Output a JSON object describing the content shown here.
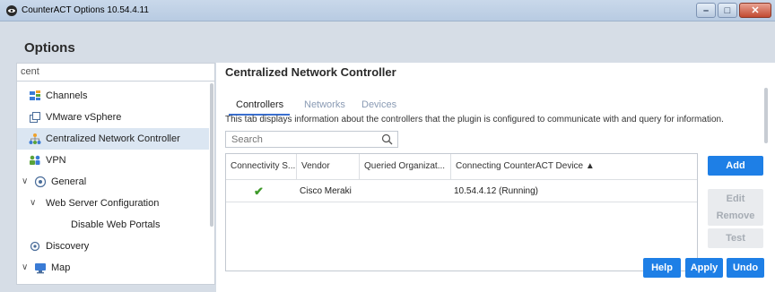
{
  "window": {
    "title": "CounterACT Options 10.54.4.11",
    "controls": {
      "minimize": "–",
      "maximize": "□",
      "close": "✕"
    }
  },
  "header": {
    "heading": "Options"
  },
  "sidebar": {
    "search_value": "cent",
    "items": [
      {
        "label": "Channels",
        "icon": "channels-icon"
      },
      {
        "label": "VMware vSphere",
        "icon": "vsphere-icon"
      },
      {
        "label": "Centralized Network Controller",
        "icon": "network-controller-icon",
        "selected": true
      },
      {
        "label": "VPN",
        "icon": "vpn-icon"
      },
      {
        "label": "General",
        "icon": "general-gear-icon",
        "expandable": true
      },
      {
        "label": "Web Server Configuration",
        "expandable": true
      },
      {
        "label": "Disable Web Portals"
      },
      {
        "label": "Discovery",
        "icon": "discovery-icon"
      },
      {
        "label": "Map",
        "icon": "map-icon",
        "expandable": true
      }
    ]
  },
  "main": {
    "title": "Centralized Network Controller",
    "tabs": [
      "Controllers",
      "Networks",
      "Devices"
    ],
    "active_tab": "Controllers",
    "description": "This tab displays information about the controllers that the plugin is configured to communicate with and query for information.",
    "search_placeholder": "Search",
    "table": {
      "columns": [
        "Connectivity S...",
        "Vendor",
        "Queried Organizat...",
        "Connecting CounterACT Device ▲"
      ],
      "rows": [
        {
          "connectivity": "✔",
          "vendor": "Cisco Meraki",
          "organization": "",
          "device": "10.54.4.12 (Running)"
        }
      ]
    },
    "side_buttons": {
      "add": "Add",
      "edit": "Edit",
      "remove": "Remove",
      "test": "Test"
    },
    "footer_buttons": {
      "help": "Help",
      "apply": "Apply",
      "undo": "Undo"
    }
  },
  "colors": {
    "accent": "#1e7fe6",
    "selected_row": "#dbe6f2",
    "check": "#3f9a2a"
  }
}
